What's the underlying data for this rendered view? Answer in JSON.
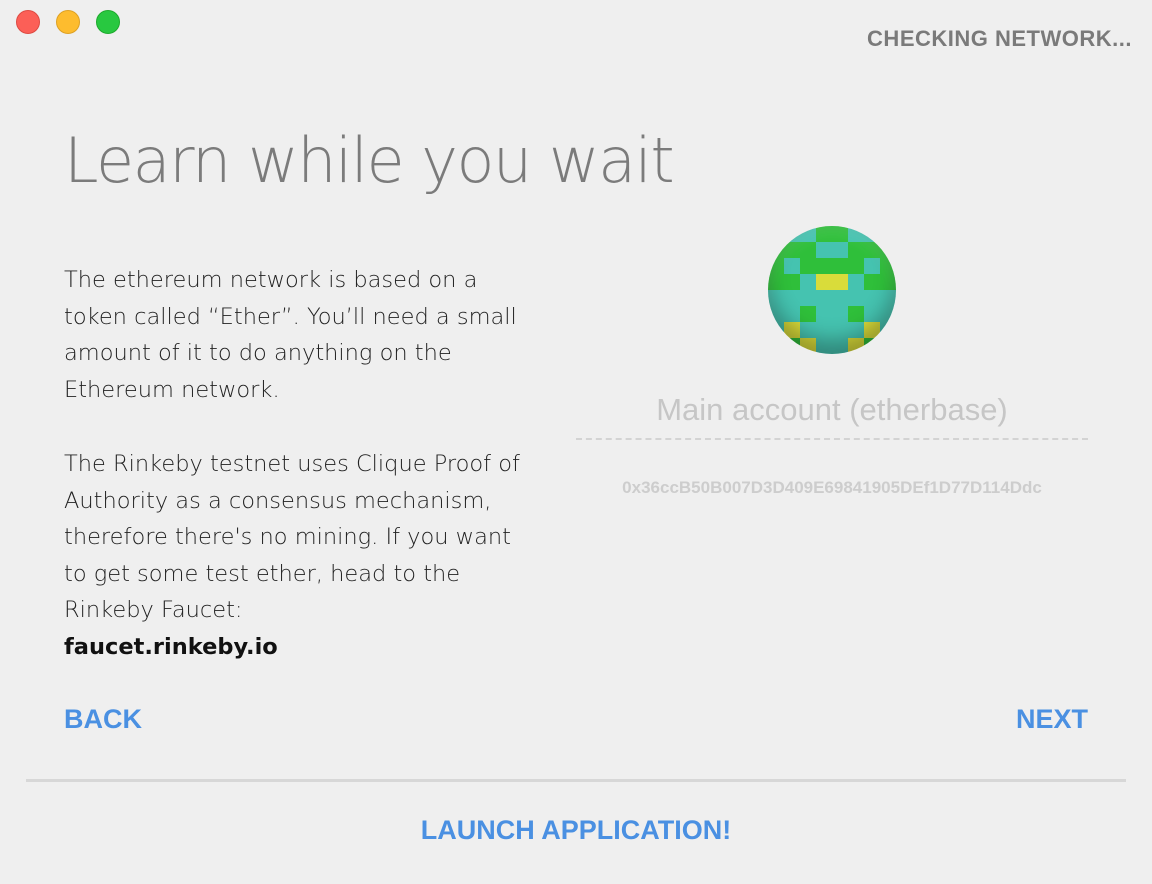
{
  "window": {
    "traffic_lights": [
      "close",
      "minimize",
      "maximize"
    ]
  },
  "status": {
    "text": "CHECKING NETWORK..."
  },
  "main": {
    "title": "Learn while you wait",
    "paragraph_1": "The ethereum network is based on a token called “Ether”. You’ll need a small amount of it to do anything on the Ethereum network.",
    "paragraph_2": "The Rinkeby testnet uses Clique Proof of Authority as a consensus mechanism, therefore there's no mining. If you want to get some test ether, head to the Rinkeby Faucet:",
    "faucet_link": "faucet.rinkeby.io"
  },
  "account": {
    "name_placeholder": "Main account (etherbase)",
    "address": "0x36ccB50B007D3D409E69841905DEf1D77D114Ddc",
    "identicon_colors": [
      "#45c3b0",
      "#2fbf3a",
      "#d9dc3a"
    ]
  },
  "navigation": {
    "back_label": "BACK",
    "next_label": "NEXT",
    "launch_label": "LAUNCH APPLICATION!"
  }
}
